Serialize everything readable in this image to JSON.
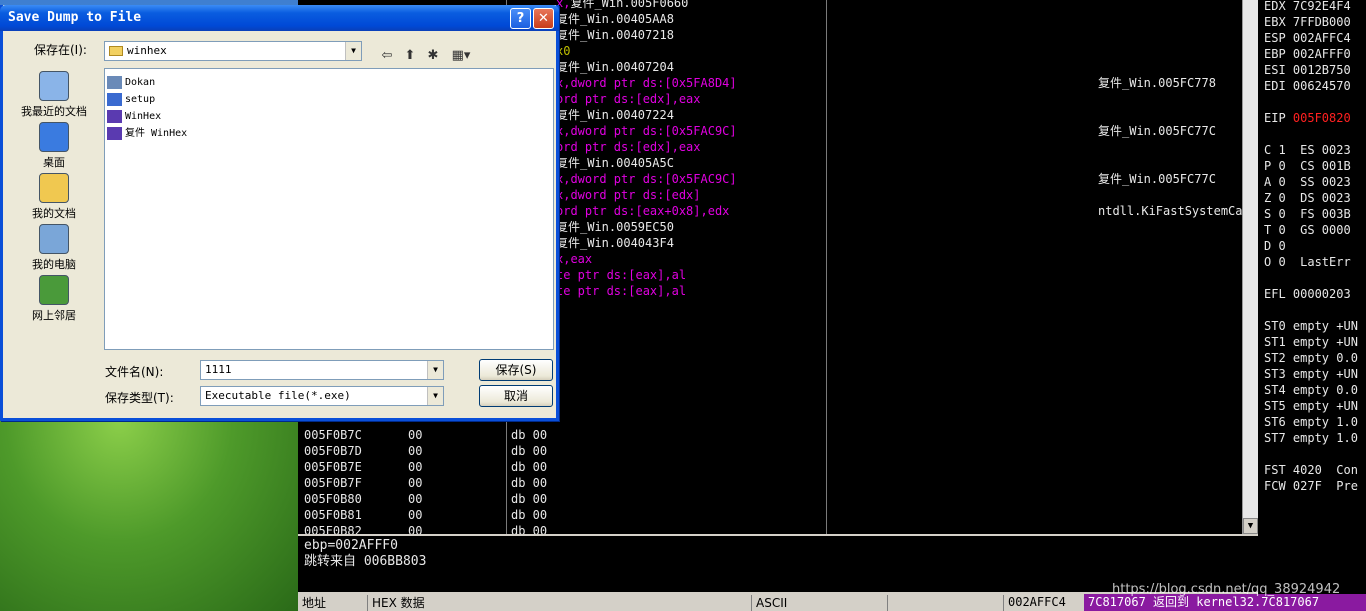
{
  "dialog": {
    "title": "Save Dump to File",
    "help_label": "?",
    "close_label": "✕",
    "save_in_label": "保存在(I):",
    "save_in_value": "winhex",
    "places": [
      {
        "label": "我最近的文档",
        "icon": "recent-documents-icon"
      },
      {
        "label": "桌面",
        "icon": "desktop-icon"
      },
      {
        "label": "我的文档",
        "icon": "my-documents-icon"
      },
      {
        "label": "我的电脑",
        "icon": "my-computer-icon"
      },
      {
        "label": "网上邻居",
        "icon": "network-places-icon"
      }
    ],
    "files": [
      {
        "name": "Dokan",
        "icon": "app-icon"
      },
      {
        "name": "setup",
        "icon": "setup-icon"
      },
      {
        "name": "WinHex",
        "icon": "hex-icon"
      },
      {
        "name": "复件 WinHex",
        "icon": "hex-icon"
      }
    ],
    "filename_label": "文件名(N):",
    "filename_value": "1111",
    "filetype_label": "保存类型(T):",
    "filetype_value": "Executable file(*.exe)",
    "save_button": "保存(S)",
    "cancel_button": "取消"
  },
  "disasm": [
    {
      "code": "复件_Win.005F0660",
      "color": "#e8e8e8",
      "prefix": "x,",
      "prefix_color": "#e000e0"
    },
    {
      "code": "复件_Win.00405AA8",
      "color": "#e8e8e8"
    },
    {
      "code": "复件_Win.00407218",
      "color": "#e8e8e8"
    },
    {
      "code": "x0",
      "color": "#c0c000"
    },
    {
      "code": "复件_Win.00407204",
      "color": "#e8e8e8"
    },
    {
      "code": "x,dword ptr ds:[0x5FA8D4]",
      "color": "#e000e0",
      "comment": "复件_Win.005FC778"
    },
    {
      "code": "ord ptr ds:[edx],eax",
      "color": "#e000e0"
    },
    {
      "code": "复件_Win.00407224",
      "color": "#e8e8e8"
    },
    {
      "code": "x,dword ptr ds:[0x5FAC9C]",
      "color": "#e000e0",
      "comment": "复件_Win.005FC77C"
    },
    {
      "code": "ord ptr ds:[edx],eax",
      "color": "#e000e0"
    },
    {
      "code": "复件_Win.00405A5C",
      "color": "#e8e8e8"
    },
    {
      "code": "x,dword ptr ds:[0x5FAC9C]",
      "color": "#e000e0",
      "comment": "复件_Win.005FC77C"
    },
    {
      "code": "x,dword ptr ds:[edx]",
      "color": "#e000e0"
    },
    {
      "code": "ord ptr ds:[eax+0x8],edx",
      "color": "#e000e0",
      "comment": "ntdll.KiFastSystemCallRet"
    },
    {
      "code": "复件_Win.0059EC50",
      "color": "#e8e8e8"
    },
    {
      "code": "复件_Win.004043F4",
      "color": "#e8e8e8"
    },
    {
      "code": "x,eax",
      "color": "#e000e0"
    },
    {
      "code": "te ptr ds:[eax],al",
      "color": "#e000e0"
    },
    {
      "code": "te ptr ds:[eax],al",
      "color": "#e000e0"
    }
  ],
  "dump": [
    {
      "addr": "005F0B7C",
      "hex": "00",
      "asm": "db 00"
    },
    {
      "addr": "005F0B7D",
      "hex": "00",
      "asm": "db 00"
    },
    {
      "addr": "005F0B7E",
      "hex": "00",
      "asm": "db 00"
    },
    {
      "addr": "005F0B7F",
      "hex": "00",
      "asm": "db 00"
    },
    {
      "addr": "005F0B80",
      "hex": "00",
      "asm": "db 00"
    },
    {
      "addr": "005F0B81",
      "hex": "00",
      "asm": "db 00"
    },
    {
      "addr": "005F0B82",
      "hex": "00",
      "asm": "db 00"
    }
  ],
  "registers": [
    {
      "text": "EDX 7C92E4F4",
      "color": "#e8e8e8"
    },
    {
      "text": "EBX 7FFDB000",
      "color": "#e8e8e8"
    },
    {
      "text": "ESP 002AFFC4",
      "color": "#e8e8e8"
    },
    {
      "text": "EBP 002AFFF0",
      "color": "#e8e8e8"
    },
    {
      "text": "ESI 0012B750",
      "color": "#e8e8e8"
    },
    {
      "text": "EDI 00624570",
      "color": "#e8e8e8"
    },
    {
      "text": "",
      "color": "#e8e8e8"
    },
    {
      "text": "EIP ",
      "color": "#e8e8e8",
      "value": "005F0820",
      "value_color": "#ff2020"
    },
    {
      "text": "",
      "color": "#e8e8e8"
    },
    {
      "text": "C 1  ES 0023",
      "color": "#e8e8e8"
    },
    {
      "text": "P 0  CS 001B",
      "color": "#e8e8e8"
    },
    {
      "text": "A 0  SS 0023",
      "color": "#e8e8e8"
    },
    {
      "text": "Z 0  DS 0023",
      "color": "#e8e8e8"
    },
    {
      "text": "S 0  FS 003B",
      "color": "#e8e8e8"
    },
    {
      "text": "T 0  GS 0000",
      "color": "#e8e8e8"
    },
    {
      "text": "D 0",
      "color": "#e8e8e8"
    },
    {
      "text": "O 0  LastErr",
      "color": "#e8e8e8"
    },
    {
      "text": "",
      "color": "#e8e8e8"
    },
    {
      "text": "EFL 00000203",
      "color": "#e8e8e8"
    },
    {
      "text": "",
      "color": "#e8e8e8"
    },
    {
      "text": "ST0 empty +UN",
      "color": "#e8e8e8"
    },
    {
      "text": "ST1 empty +UN",
      "color": "#e8e8e8"
    },
    {
      "text": "ST2 empty 0.0",
      "color": "#e8e8e8"
    },
    {
      "text": "ST3 empty +UN",
      "color": "#e8e8e8"
    },
    {
      "text": "ST4 empty 0.0",
      "color": "#e8e8e8"
    },
    {
      "text": "ST5 empty +UN",
      "color": "#e8e8e8"
    },
    {
      "text": "ST6 empty 1.0",
      "color": "#e8e8e8"
    },
    {
      "text": "ST7 empty 1.0",
      "color": "#e8e8e8"
    },
    {
      "text": "",
      "color": "#e8e8e8"
    },
    {
      "text": "FST 4020  Con",
      "color": "#e8e8e8"
    },
    {
      "text": "FCW 027F  Pre",
      "color": "#e8e8e8"
    }
  ],
  "info": {
    "line1": "ebp=002AFFF0",
    "line2": "跳转来自 006BB803"
  },
  "dump_header": {
    "address": "地址",
    "hex": "HEX 数据",
    "ascii": "ASCII"
  },
  "status": {
    "stack_addr": "002AFFC4",
    "stack_info": "7C817067  返回到 kernel32.7C817067"
  },
  "watermark": "https://blog.csdn.net/qq_38924942",
  "scroll_label": "▼"
}
